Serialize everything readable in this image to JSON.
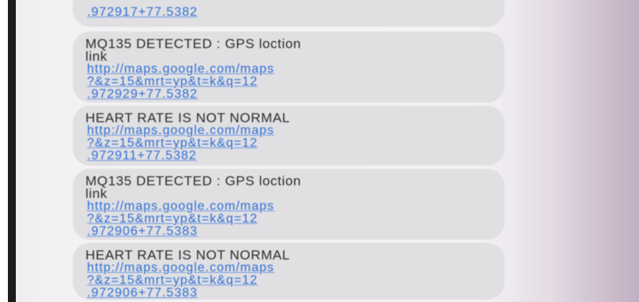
{
  "messages": [
    {
      "text": "",
      "link_lines": [
        ".972917+77.5382"
      ]
    },
    {
      "text_lines": [
        "MQ135 DETECTED : GPS loction",
        "link"
      ],
      "link_lines": [
        "http://maps.google.com/maps",
        "?&z=15&mrt=yp&t=k&q=12",
        ".972929+77.5382"
      ]
    },
    {
      "text_lines": [
        "HEART RATE IS NOT NORMAL"
      ],
      "link_lines": [
        "http://maps.google.com/maps",
        "?&z=15&mrt=yp&t=k&q=12",
        ".972911+77.5382"
      ]
    },
    {
      "text_lines": [
        "MQ135 DETECTED : GPS loction",
        "link"
      ],
      "link_lines": [
        "http://maps.google.com/maps",
        "?&z=15&mrt=yp&t=k&q=12",
        ".972906+77.5383"
      ]
    },
    {
      "text_lines": [
        "HEART RATE IS NOT NORMAL"
      ],
      "link_lines": [
        "http://maps.google.com/maps",
        "?&z=15&mrt=yp&t=k&q=12",
        ".972906+77.5383"
      ]
    }
  ],
  "colors": {
    "bubble": "#e0dfe2",
    "text": "#2b2b2b",
    "link": "#2f6fd6"
  }
}
